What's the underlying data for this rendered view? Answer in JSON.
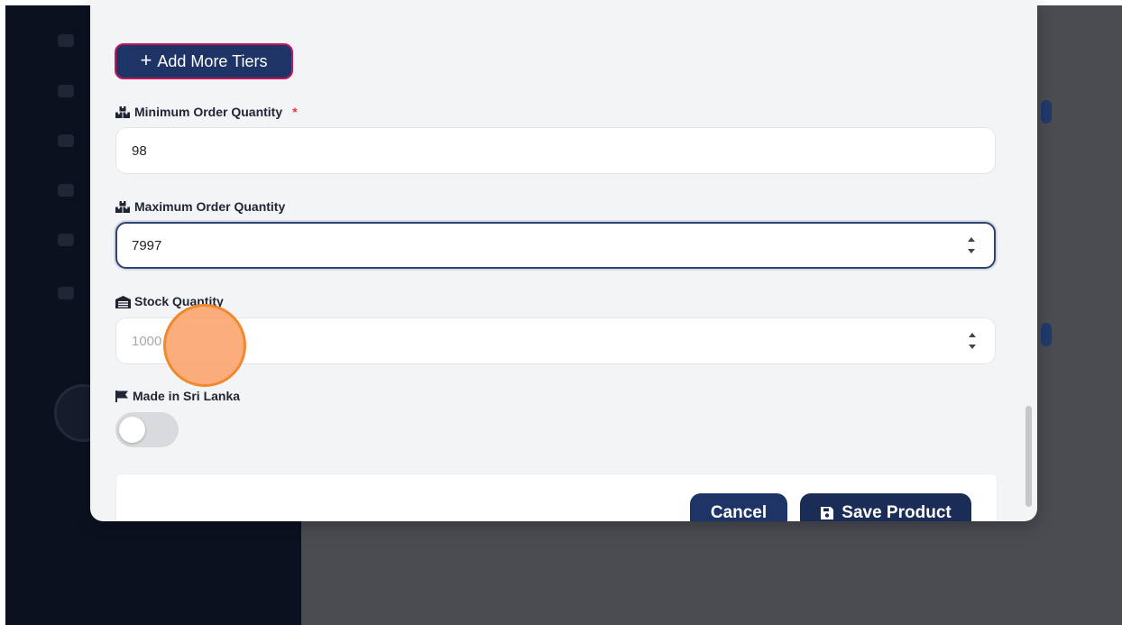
{
  "modal": {
    "add_tiers_label": "Add More Tiers",
    "min_order": {
      "label": "Minimum Order Quantity",
      "required_mark": "*",
      "value": "98",
      "icon": "boxes-icon"
    },
    "max_order": {
      "label": "Maximum Order Quantity",
      "value": "7997",
      "icon": "boxes-icon"
    },
    "stock": {
      "label": "Stock Quantity",
      "placeholder": "1000",
      "icon": "warehouse-icon"
    },
    "made_in": {
      "label": "Made in Sri Lanka",
      "icon": "flag-icon",
      "toggle_on": false
    },
    "cancel_label": "Cancel",
    "save_label": "Save Product",
    "save_icon": "save-icon"
  },
  "colors": {
    "primary": "#1e3466",
    "required": "#e53935",
    "click_indicator": "#f0892e"
  }
}
